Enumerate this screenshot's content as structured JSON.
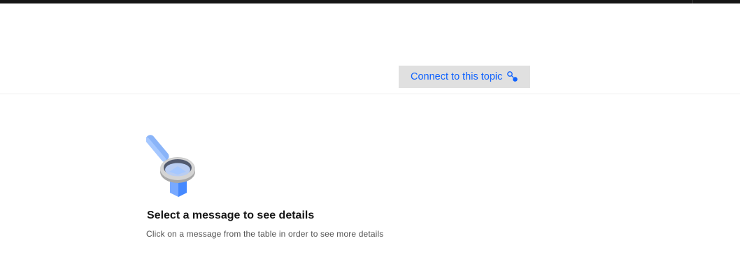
{
  "header": {
    "connect_button_label": "Connect to this topic",
    "connect_icon": "connect-icon"
  },
  "empty_state": {
    "illustration": "magnifying-glass-icon",
    "title": "Select a message to see details",
    "description": "Click on a message from the table in order to see more details"
  },
  "colors": {
    "accent": "#0f62fe",
    "button_bg": "#e0e0e0",
    "top_bar": "#161616"
  }
}
